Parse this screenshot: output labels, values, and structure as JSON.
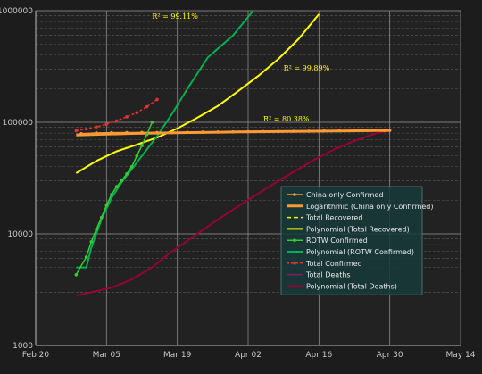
{
  "chart_data": {
    "type": "line",
    "yscale": "log",
    "ylim": [
      1000,
      1000000
    ],
    "xlim": [
      "2020-02-20",
      "2020-05-14"
    ],
    "grid": true,
    "legend_placement": "bottom-right",
    "x_ticks": [
      "Feb 20",
      "Mar 05",
      "Mar 19",
      "Apr 02",
      "Apr 16",
      "Apr 30",
      "May 14"
    ],
    "y_ticks": [
      "1000",
      "10000",
      "100000",
      "1000000"
    ],
    "annotations": [
      {
        "text": "R² = 99.11%",
        "x": "2020-03-14",
        "y": 850000,
        "color": "#ffff00"
      },
      {
        "text": "R² = 99.89%",
        "x": "2020-04-09",
        "y": 290000,
        "color": "#ffff00"
      },
      {
        "text": "R² = 80.38%",
        "x": "2020-04-05",
        "y": 102000,
        "color": "#ffff00"
      }
    ],
    "series": [
      {
        "name": "China only Confirmed",
        "color": "#ff9933",
        "marker": "dot",
        "dash": "",
        "x": [
          "2020-02-29",
          "2020-03-03",
          "2020-03-06",
          "2020-03-09",
          "2020-03-12",
          "2020-03-15",
          "2020-03-18",
          "2020-03-21",
          "2020-03-24",
          "2020-03-27",
          "2020-03-30",
          "2020-04-02",
          "2020-04-05",
          "2020-04-08",
          "2020-04-11",
          "2020-04-14",
          "2020-04-17",
          "2020-04-20",
          "2020-04-23",
          "2020-04-26",
          "2020-04-29",
          "2020-04-30"
        ],
        "y": [
          79000,
          80200,
          80700,
          80900,
          80950,
          81000,
          81100,
          81300,
          81500,
          81800,
          82000,
          82400,
          82600,
          82800,
          83000,
          83300,
          83600,
          84200,
          84400,
          84500,
          84600,
          84700
        ]
      },
      {
        "name": "Logarithmic (China only Confirmed)",
        "color": "#ff9933",
        "marker": "",
        "dash": "",
        "width": 3,
        "x": [
          "2020-02-28",
          "2020-03-10",
          "2020-03-20",
          "2020-03-31",
          "2020-04-10",
          "2020-04-20",
          "2020-04-30"
        ],
        "y": [
          77000,
          79500,
          80800,
          82000,
          82800,
          83600,
          84500
        ]
      },
      {
        "name": "Total Recovered",
        "color": "#ffee00",
        "marker": "",
        "dash": "5,3",
        "x": [],
        "y": []
      },
      {
        "name": "Polynomial (Total Recovered)",
        "color": "#ffff00",
        "marker": "",
        "dash": "",
        "width": 2,
        "x": [
          "2020-02-28",
          "2020-03-03",
          "2020-03-07",
          "2020-03-11",
          "2020-03-15",
          "2020-03-19",
          "2020-03-23",
          "2020-03-27",
          "2020-03-31",
          "2020-04-04",
          "2020-04-08",
          "2020-04-12",
          "2020-04-16"
        ],
        "y": [
          35000,
          45000,
          55000,
          63000,
          73000,
          88000,
          110000,
          140000,
          190000,
          260000,
          370000,
          560000,
          930000
        ]
      },
      {
        "name": "ROTW Confirmed",
        "color": "#33cc33",
        "marker": "dot",
        "dash": "",
        "x": [
          "2020-02-28",
          "2020-03-01",
          "2020-03-02",
          "2020-03-03",
          "2020-03-04",
          "2020-03-05",
          "2020-03-06",
          "2020-03-07",
          "2020-03-08",
          "2020-03-09",
          "2020-03-10",
          "2020-03-11",
          "2020-03-12",
          "2020-03-13",
          "2020-03-14"
        ],
        "y": [
          4300,
          6200,
          8500,
          11000,
          14000,
          18000,
          22500,
          26500,
          30000,
          34500,
          40000,
          50000,
          62000,
          78000,
          100000
        ]
      },
      {
        "name": "Polynomial (ROTW Confirmed)",
        "color": "#00b050",
        "marker": "",
        "dash": "",
        "width": 2,
        "x": [
          "2020-02-28",
          "2020-03-01",
          "2020-03-02",
          "2020-03-04",
          "2020-03-06",
          "2020-03-08",
          "2020-03-10",
          "2020-03-12",
          "2020-03-15",
          "2020-03-18",
          "2020-03-21",
          "2020-03-25",
          "2020-03-30",
          "2020-04-03"
        ],
        "y": [
          5000,
          5000,
          7500,
          13500,
          21000,
          29000,
          38000,
          50000,
          75000,
          120000,
          200000,
          380000,
          600000,
          1000000
        ]
      },
      {
        "name": "Total Confirmed",
        "color": "#dd3333",
        "marker": "dot",
        "dash": "3,2",
        "x": [
          "2020-02-28",
          "2020-03-01",
          "2020-03-03",
          "2020-03-05",
          "2020-03-07",
          "2020-03-09",
          "2020-03-11",
          "2020-03-13",
          "2020-03-15"
        ],
        "y": [
          84000,
          87000,
          91000,
          96000,
          103000,
          112000,
          122000,
          138000,
          160000
        ]
      },
      {
        "name": "Total Deaths",
        "color": "#8b1a5c",
        "marker": "",
        "dash": "",
        "x": [],
        "y": []
      },
      {
        "name": "Polynomial (Total Deaths)",
        "color": "#990033",
        "marker": "",
        "dash": "",
        "width": 2,
        "x": [
          "2020-02-28",
          "2020-03-02",
          "2020-03-06",
          "2020-03-10",
          "2020-03-14",
          "2020-03-18",
          "2020-03-22",
          "2020-03-26",
          "2020-03-30",
          "2020-04-03",
          "2020-04-07",
          "2020-04-11",
          "2020-04-15",
          "2020-04-19",
          "2020-04-23",
          "2020-04-27",
          "2020-04-30"
        ],
        "y": [
          2800,
          3000,
          3300,
          3900,
          5000,
          7000,
          9300,
          12500,
          16500,
          21500,
          28000,
          36000,
          46000,
          57000,
          68000,
          79000,
          84000
        ]
      }
    ]
  }
}
